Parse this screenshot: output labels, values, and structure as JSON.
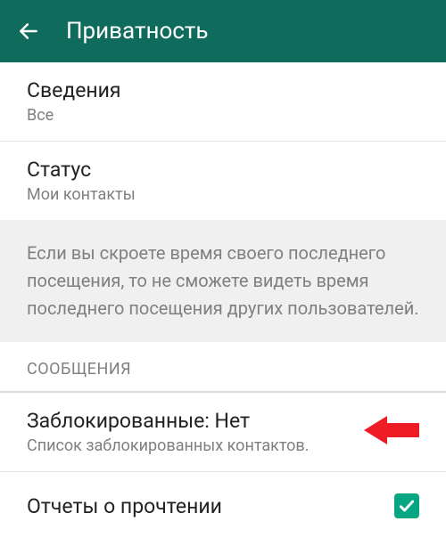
{
  "header": {
    "title": "Приватность"
  },
  "items": {
    "about": {
      "title": "Сведения",
      "subtitle": "Все"
    },
    "status": {
      "title": "Статус",
      "subtitle": "Мои контакты"
    }
  },
  "info_text": "Если вы скроете время своего последнего посещения, то не сможете видеть время последнего посещения других пользователей.",
  "section": {
    "messages": "СООБЩЕНИЯ"
  },
  "blocked": {
    "title": "Заблокированные: Нет",
    "subtitle": "Список заблокированных контактов."
  },
  "read_receipts": {
    "title": "Отчеты о прочтении"
  },
  "colors": {
    "header_bg": "#0f6b5c",
    "accent": "#06a682",
    "arrow": "#ee1c25"
  }
}
